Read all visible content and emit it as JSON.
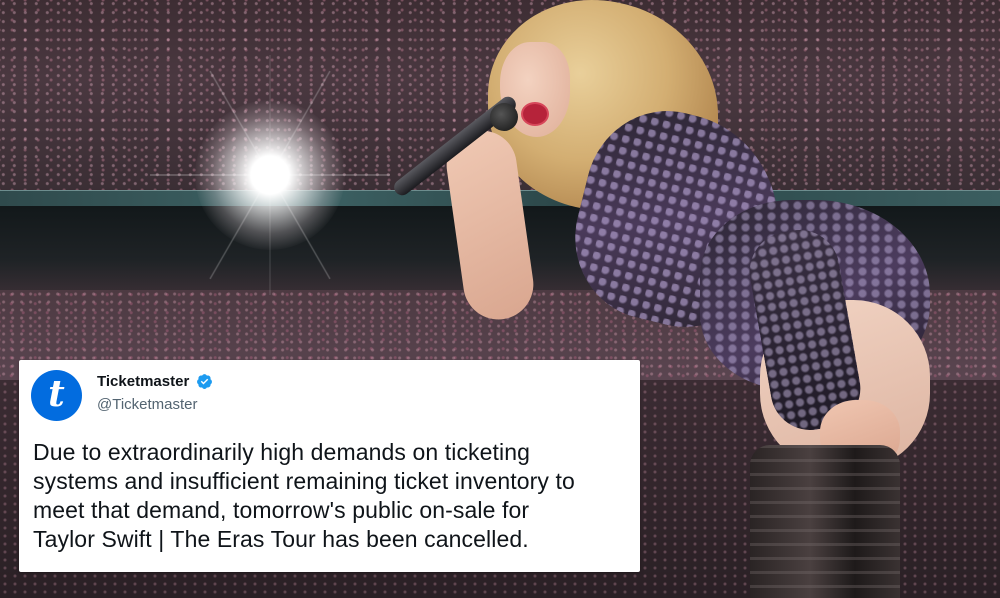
{
  "tweet": {
    "account_name": "Ticketmaster",
    "account_handle": "@Ticketmaster",
    "avatar_letter": "t",
    "avatar_color": "#026cdf",
    "verified_color": "#1d9bf0",
    "text_lines": [
      "Due to extraordinarily high demands on ticketing",
      "systems and insufficient remaining ticket inventory to",
      "meet that demand, tomorrow's public on-sale for",
      "Taylor Swift | The Eras Tour has been cancelled."
    ]
  },
  "photo": {
    "stage_lighting": "spotlight-icon",
    "ribbon_board_color": "#3d6264"
  }
}
